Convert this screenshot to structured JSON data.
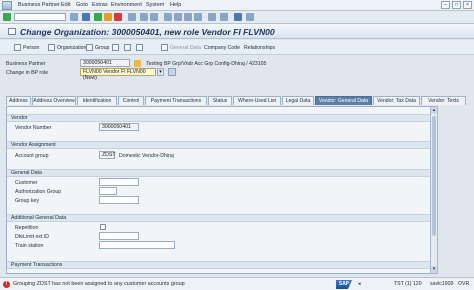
{
  "menu": [
    "Business Partner",
    "Edit",
    "Goto",
    "Extras",
    "Environment",
    "System",
    "Help"
  ],
  "title": "Change Organization: 3000050401, new role Vendor FI FLVN00",
  "app_toolbar": {
    "person": "Person",
    "organization": "Organization",
    "group": "Group",
    "general_data": "General Data",
    "company_code": "Company Code",
    "relationships": "Relationships"
  },
  "header": {
    "bp_label": "Business Partner",
    "bp_value": "3000050401",
    "bp_desc": "Testing BP Grp/Vndr Acc Grp Config-Dhiraj / 423105",
    "role_label": "Change in BP role",
    "role_value": "FLVN00 Vendor FI FLVN00 (New)"
  },
  "tabs": [
    "Address",
    "Address Overview",
    "Identification",
    "Control",
    "Payment Transactions",
    "Status",
    "Where-Used List",
    "Legal Data",
    "Vendor: General Data",
    "Vendor: Tax Data",
    "Vendor: Texts"
  ],
  "active_tab": "Vendor: General Data",
  "sections": {
    "vendor": {
      "title": "Vendor",
      "vendor_number_label": "Vendor Number",
      "vendor_number": "3000050401"
    },
    "assignment": {
      "title": "Vendor Assignment",
      "account_group_label": "Account group",
      "account_group": "ZDST",
      "account_group_desc": "Domestic Vendor-Dhiraj"
    },
    "general": {
      "title": "General Data",
      "customer": "Customer",
      "authorization_group": "Authorization Group",
      "group_key": "Group key"
    },
    "additional": {
      "title": "Additional General Data",
      "repetition": "Repetition",
      "dtelimit": "DteLimit ext.ID",
      "train_station": "Train station"
    },
    "payment": {
      "title": "Payment Transactions"
    }
  },
  "status": {
    "message": "Grouping ZDST has not been assigned to any customer accounts group",
    "sap": "SAP",
    "system": "TST (1) 120",
    "server": "savlc1909",
    "mode": "OVR"
  },
  "colors": {
    "active_tab": "#5b7fa8",
    "error": "#d62b2b",
    "title": "#1b3557"
  }
}
